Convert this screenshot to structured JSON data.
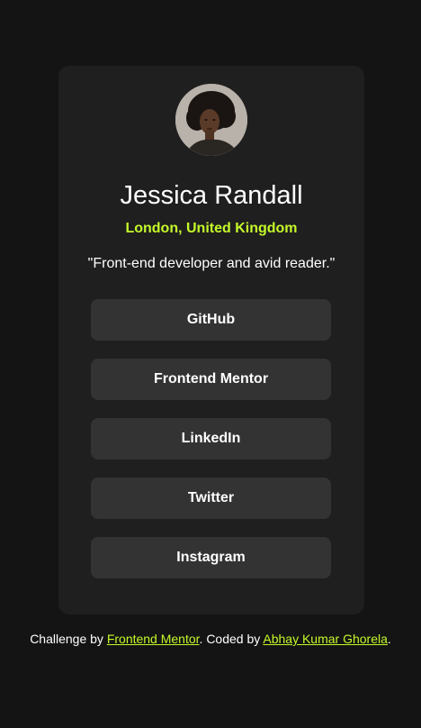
{
  "profile": {
    "name": "Jessica Randall",
    "location": "London, United Kingdom",
    "bio": "\"Front-end developer and avid reader.\"",
    "avatar_icon": "avatar-photo"
  },
  "links": [
    {
      "label": "GitHub"
    },
    {
      "label": "Frontend Mentor"
    },
    {
      "label": "LinkedIn"
    },
    {
      "label": "Twitter"
    },
    {
      "label": "Instagram"
    }
  ],
  "footer": {
    "prefix": "Challenge by ",
    "challenge_link": "Frontend Mentor",
    "middle": ". Coded by ",
    "author_link": "Abhay Kumar Ghorela",
    "suffix": "."
  },
  "colors": {
    "background": "#141414",
    "card": "#1f1f1f",
    "button": "#333333",
    "accent": "#c4f82a",
    "text": "#ffffff"
  }
}
